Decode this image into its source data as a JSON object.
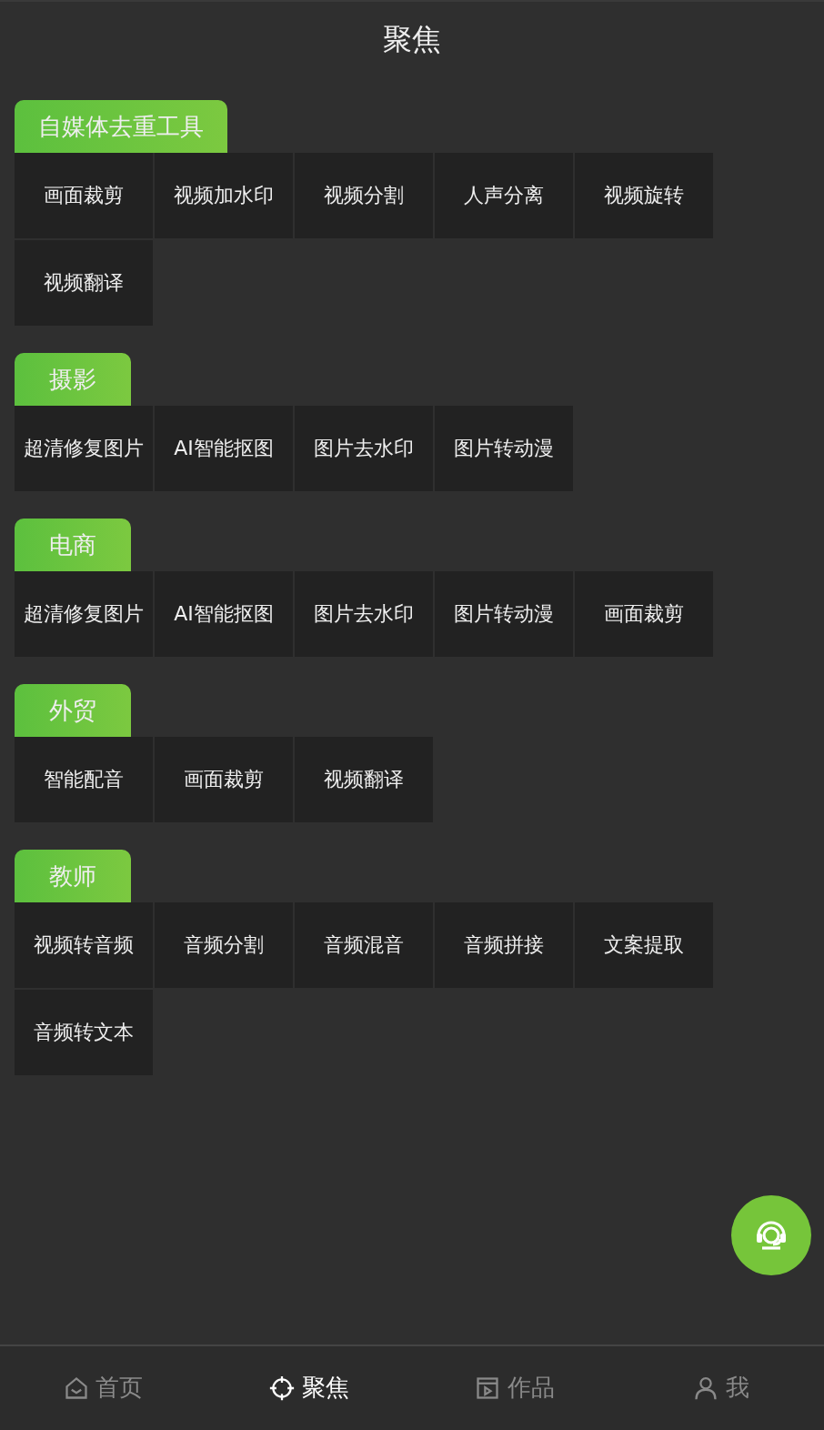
{
  "header": {
    "title": "聚焦"
  },
  "sections": [
    {
      "title": "自媒体去重工具",
      "tools": [
        "画面裁剪",
        "视频加水印",
        "视频分割",
        "人声分离",
        "视频旋转",
        "视频翻译"
      ]
    },
    {
      "title": "摄影",
      "tools": [
        "超清修复图片",
        "AI智能抠图",
        "图片去水印",
        "图片转动漫"
      ]
    },
    {
      "title": "电商",
      "tools": [
        "超清修复图片",
        "AI智能抠图",
        "图片去水印",
        "图片转动漫",
        "画面裁剪"
      ]
    },
    {
      "title": "外贸",
      "tools": [
        "智能配音",
        "画面裁剪",
        "视频翻译"
      ]
    },
    {
      "title": "教师",
      "tools": [
        "视频转音频",
        "音频分割",
        "音频混音",
        "音频拼接",
        "文案提取",
        "音频转文本"
      ]
    }
  ],
  "tab_bar": [
    {
      "kind": "home",
      "label": "首页",
      "selected": false
    },
    {
      "kind": "focus",
      "label": "聚焦",
      "selected": true
    },
    {
      "kind": "works",
      "label": "作品",
      "selected": false
    },
    {
      "kind": "me",
      "label": "我",
      "selected": false
    }
  ]
}
